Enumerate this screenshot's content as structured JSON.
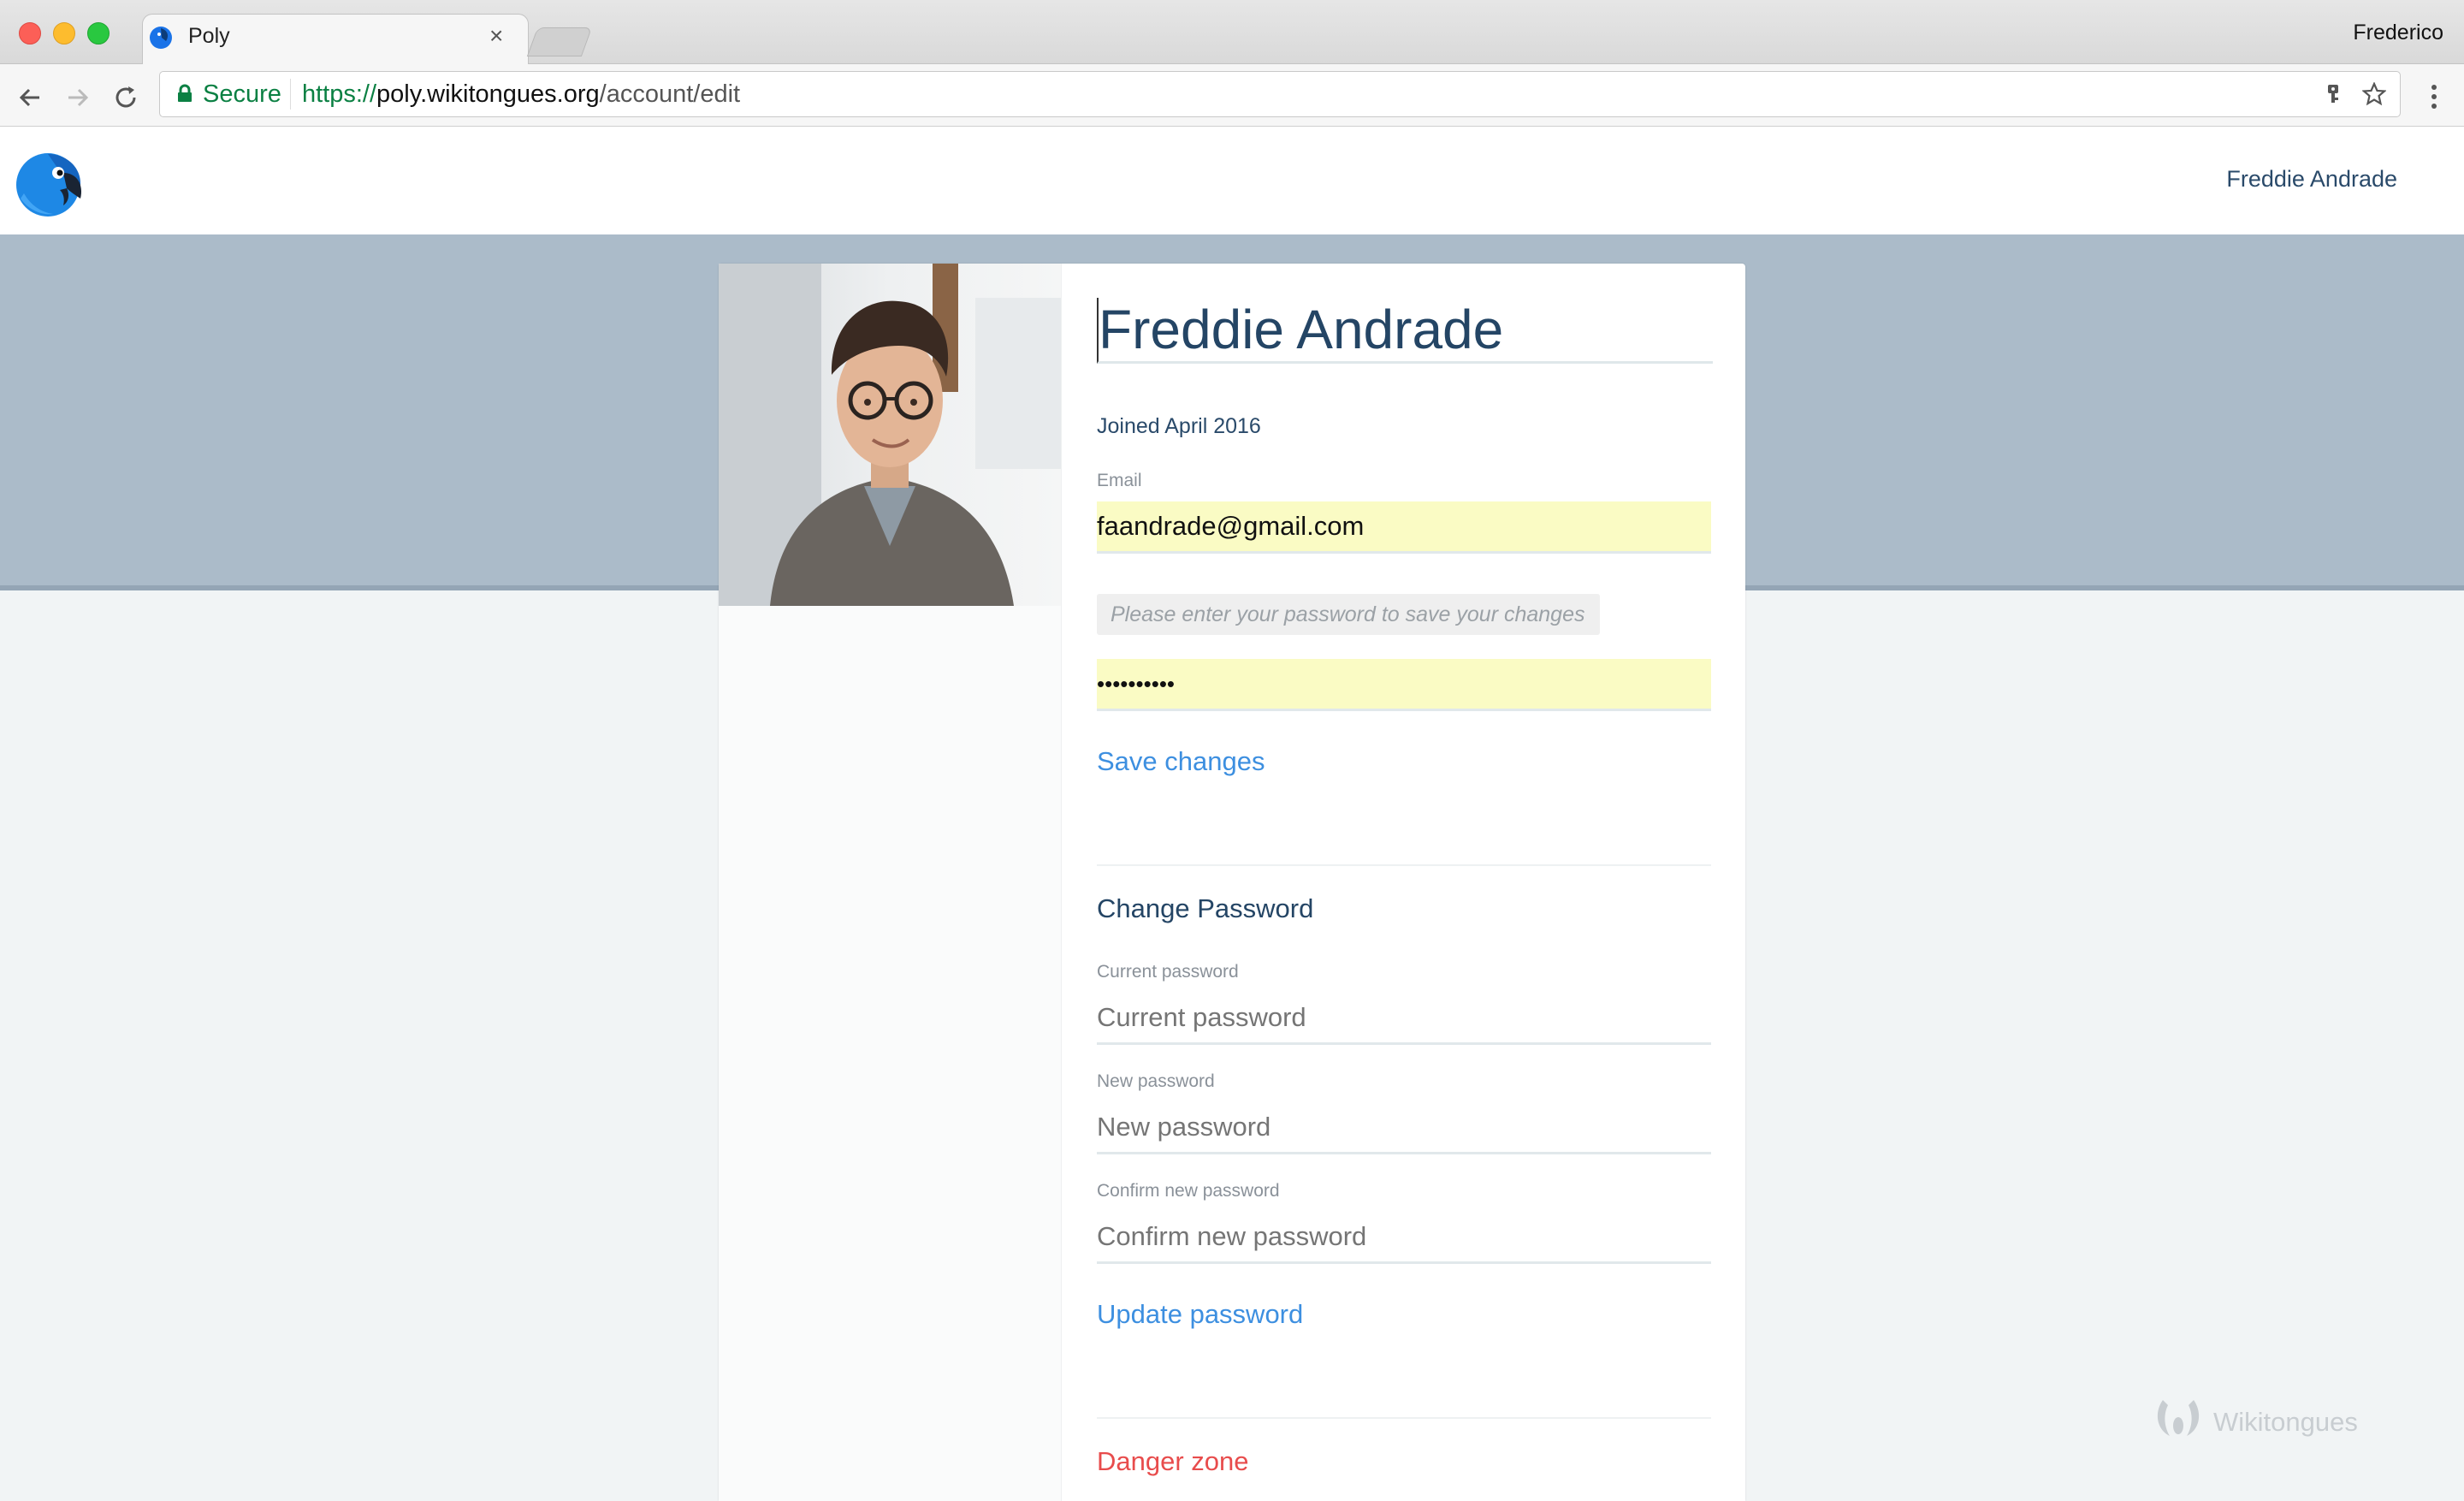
{
  "browser": {
    "tab_title": "Poly",
    "tab_close": "×",
    "profile_name": "Frederico",
    "secure_label": "Secure",
    "url_protocol": "https://",
    "url_host": "poly.wikitongues.org",
    "url_path": "/account/edit"
  },
  "header": {
    "user_name": "Freddie Andrade"
  },
  "profile": {
    "name": "Freddie Andrade",
    "joined": "Joined April 2016",
    "email_label": "Email",
    "email_value": "faandrade@gmail.com",
    "password_hint": "Please enter your password to save your changes",
    "password_value": "••••••••••",
    "save_label": "Save changes"
  },
  "change_password": {
    "title": "Change Password",
    "current_label": "Current password",
    "current_placeholder": "Current password",
    "new_label": "New password",
    "new_placeholder": "New password",
    "confirm_label": "Confirm new password",
    "confirm_placeholder": "Confirm new password",
    "update_label": "Update password"
  },
  "danger_zone": {
    "title": "Danger zone"
  },
  "footer": {
    "brand": "Wikitongues"
  },
  "colors": {
    "accent_link": "#3d8fe0",
    "title_navy": "#244565",
    "danger": "#e84c4c",
    "autofill": "#fafbc4",
    "hero": "#abbbc9"
  },
  "icons": [
    "back-icon",
    "forward-icon",
    "reload-icon",
    "lock-icon",
    "key-icon",
    "star-icon",
    "menu-icon",
    "parrot-logo-icon",
    "wikitongues-logo-icon"
  ]
}
